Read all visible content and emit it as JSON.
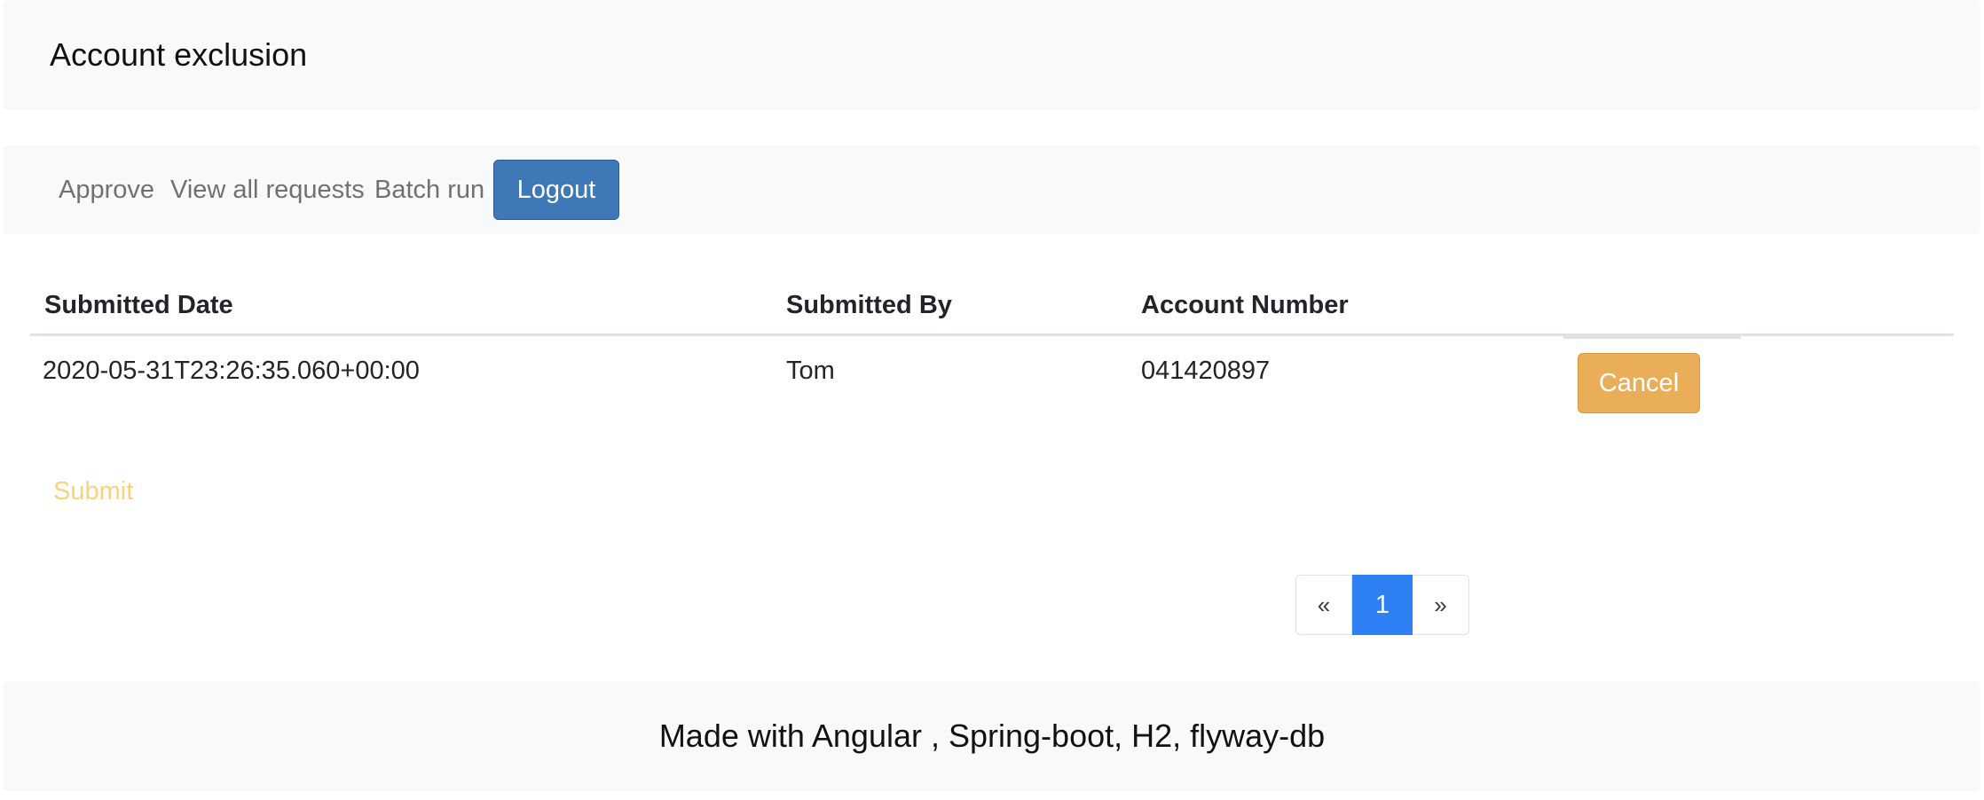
{
  "header": {
    "title": "Account exclusion"
  },
  "nav": {
    "approve_label": "Approve",
    "view_all_label": "View all requests",
    "batch_run_label": "Batch run",
    "logout_label": "Logout"
  },
  "table": {
    "columns": [
      "Submitted Date",
      "Submitted By",
      "Account Number"
    ],
    "rows": [
      {
        "submitted_date": "2020-05-31T23:26:35.060+00:00",
        "submitted_by": "Tom",
        "account_number": "041420897",
        "action_label": "Cancel"
      }
    ]
  },
  "form": {
    "submit_label": "Submit"
  },
  "pagination": {
    "prev_label": "«",
    "current_page": "1",
    "next_label": "»"
  },
  "footer": {
    "text": "Made with Angular , Spring-boot, H2, flyway-db"
  },
  "colors": {
    "primary": "#3f78b6",
    "warning": "#e9ae57",
    "active_page": "#2f80f4",
    "submit_disabled": "#f9d27a",
    "panel_bg": "#f8f9fa"
  }
}
